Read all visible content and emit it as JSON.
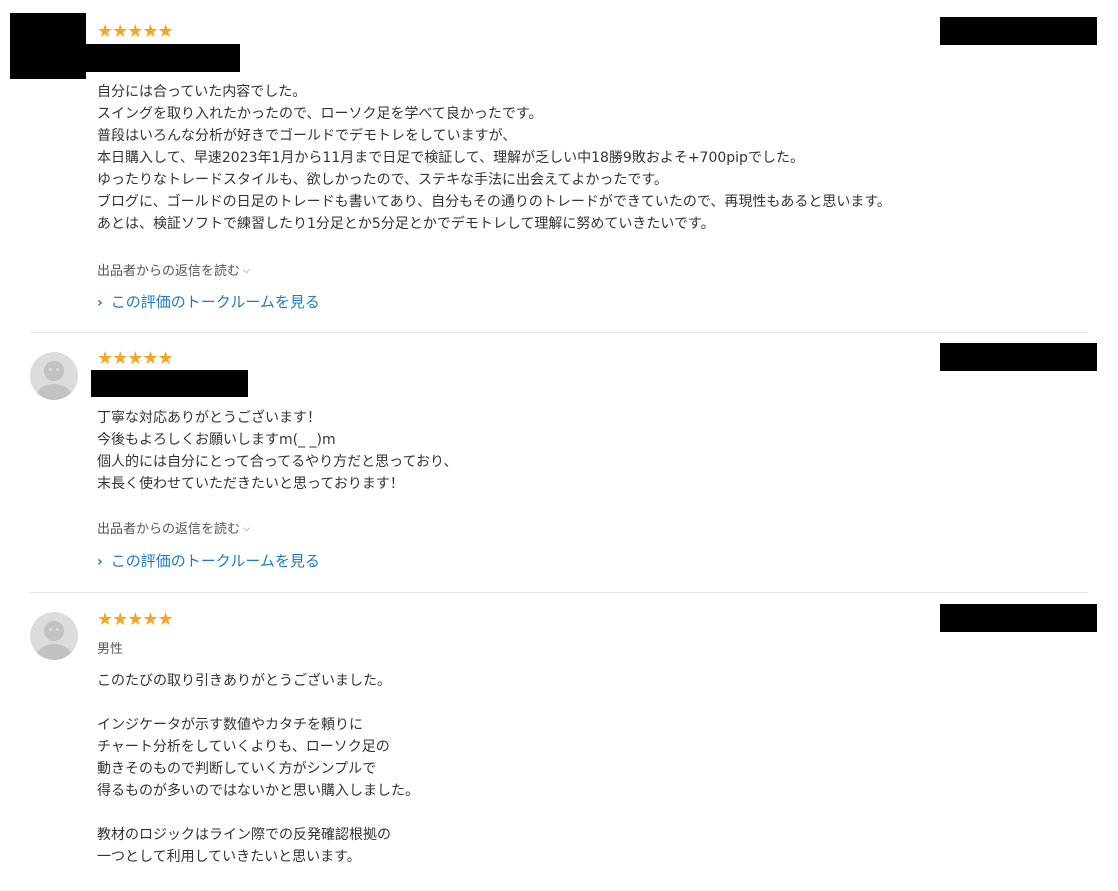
{
  "reviews": [
    {
      "rating": "★★★★★",
      "body_lines": [
        "自分には合っていた内容でした。",
        "スイングを取り入れたかったので、ローソク足を学べて良かったです。",
        "普段はいろんな分析が好きでゴールドでデモトレをしていますが、",
        "本日購入して、早速2023年1月から11月まで日足で検証して、理解が乏しい中18勝9敗およそ+700pipでした。",
        "ゆったりなトレードスタイルも、欲しかったので、ステキな手法に出会えてよかったです。",
        "ブログに、ゴールドの日足のトレードも書いてあり、自分もその通りのトレードができていたので、再現性もあると思います。",
        "あとは、検証ソフトで練習したり1分足とか5分足とかでデモトレして理解に努めていきたいです。"
      ],
      "reply_label": "出品者からの返信を読む",
      "talk_label": "この評価のトークルームを見る"
    },
    {
      "rating": "★★★★★",
      "body_lines": [
        "丁寧な対応ありがとうございます！",
        "今後もよろしくお願いしますm(_ _)m",
        "個人的には自分にとって合ってるやり方だと思っており、",
        "末長く使わせていただきたいと思っております！"
      ],
      "reply_label": "出品者からの返信を読む",
      "talk_label": "この評価のトークルームを見る"
    },
    {
      "rating": "★★★★★",
      "user_label": "男性",
      "body_lines": [
        "このたびの取り引きありがとうございました。",
        "",
        "インジケータが示す数値やカタチを頼りに",
        "チャート分析をしていくよりも、ローソク足の",
        "動きそのもので判断していく方がシンプルで",
        "得るものが多いのではないかと思い購入しました。",
        "",
        "教材のロジックはライン際での反発確認根拠の",
        "一つとして利用していきたいと思います。"
      ]
    }
  ],
  "colors": {
    "star": "#f5a623",
    "link": "#1f7ac4"
  },
  "icons": {
    "reply_chevron": "chevron-down-icon",
    "talk_arrow": "chevron-right-icon"
  }
}
